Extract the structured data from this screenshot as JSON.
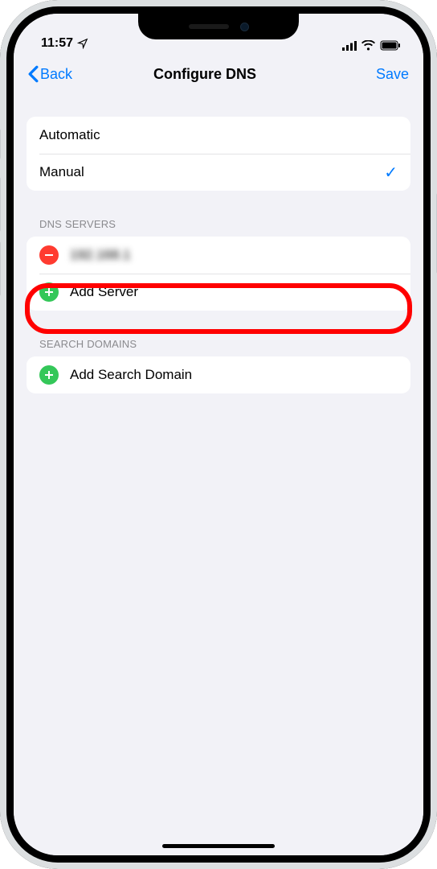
{
  "status_bar": {
    "time": "11:57"
  },
  "nav": {
    "back_label": "Back",
    "title": "Configure DNS",
    "save_label": "Save"
  },
  "mode_group": {
    "automatic_label": "Automatic",
    "manual_label": "Manual",
    "selected": "manual"
  },
  "dns_servers": {
    "header": "DNS SERVERS",
    "server0_value": "192.168.1",
    "add_label": "Add Server"
  },
  "search_domains": {
    "header": "SEARCH DOMAINS",
    "add_label": "Add Search Domain"
  },
  "colors": {
    "accent": "#007aff",
    "green": "#34c759",
    "red": "#ff3b30",
    "highlight": "#ff0000"
  }
}
